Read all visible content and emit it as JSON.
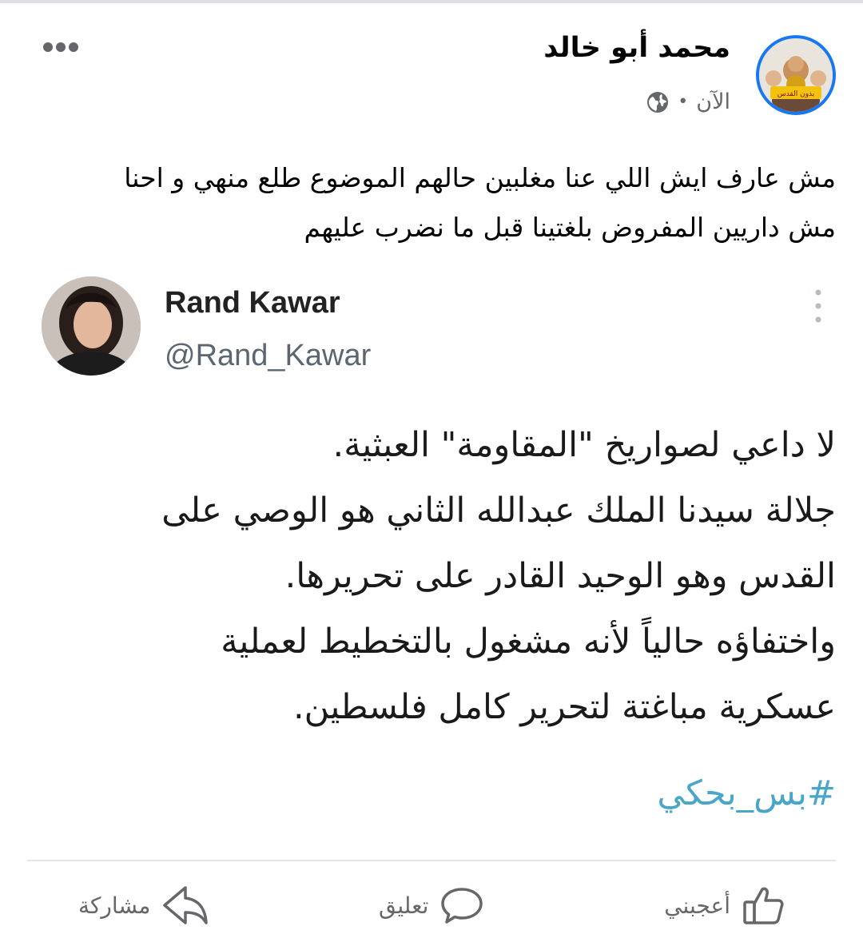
{
  "post": {
    "author_name": "محمد أبو خالد",
    "timestamp": "الآن",
    "meta_separator": "•",
    "text_lines": [
      "مش عارف ايش اللي عنا مغلبين حالهم الموضوع طلع منهي و احنا",
      "مش داريين المفروض بلغتينا قبل ما نضرب عليهم"
    ],
    "avatar_caption": "بدون القدس"
  },
  "tweet": {
    "name": "Rand Kawar",
    "handle": "@Rand_Kawar",
    "body_lines": [
      "لا داعي لصواريخ \"المقاومة\" العبثية.",
      "جلالة سيدنا الملك عبدالله الثاني هو الوصي على",
      "القدس وهو الوحيد القادر على تحريرها.",
      "واختفاؤه حالياً لأنه مشغول بالتخطيط لعملية",
      "عسكرية مباغتة لتحرير كامل فلسطين."
    ],
    "hashtag": "#بس_بحكي"
  },
  "actions": {
    "like_label": "أعجبني",
    "comment_label": "تعليق",
    "share_label": "مشاركة"
  },
  "colors": {
    "accent": "#1877f2",
    "secondary_text": "#65676b",
    "hashtag": "#4aa6c9"
  }
}
